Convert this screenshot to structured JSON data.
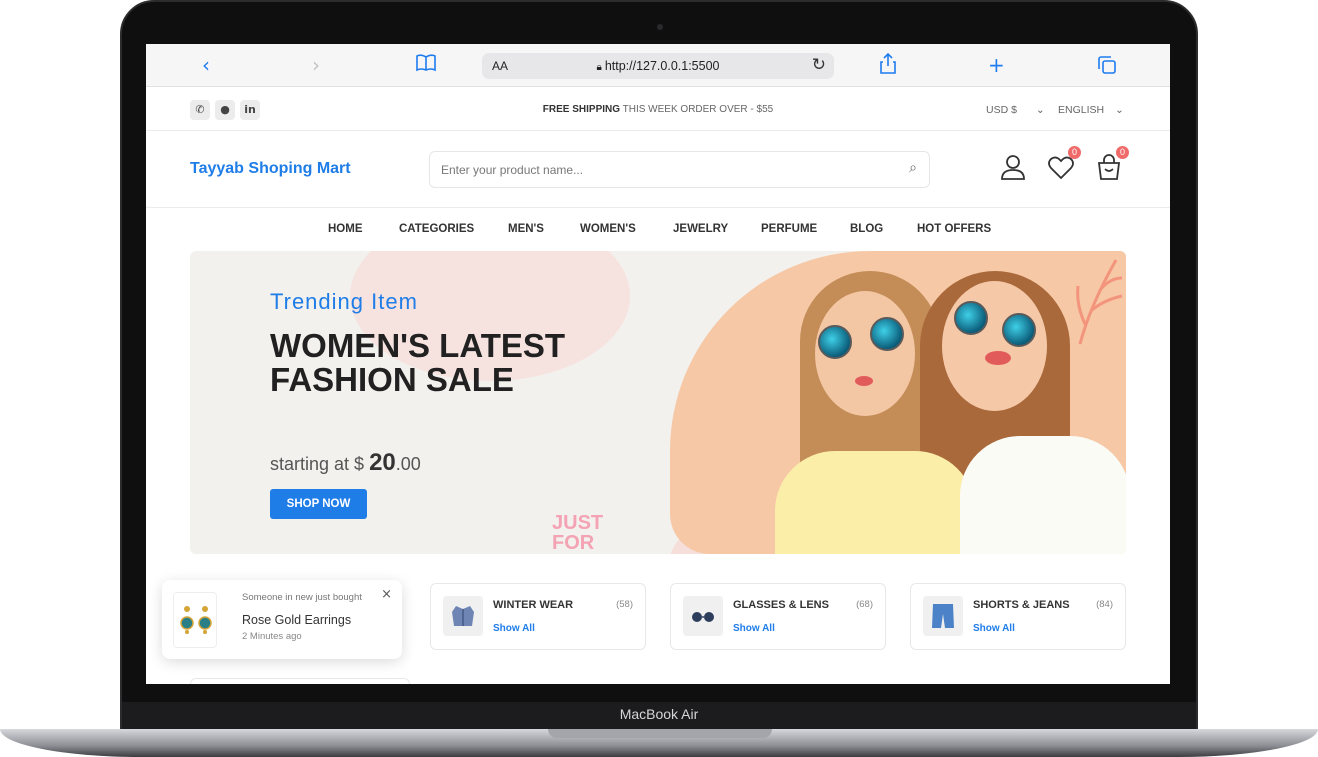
{
  "device": {
    "model_label": "MacBook Air"
  },
  "browser": {
    "text_size_label": "AA",
    "url": "http://127.0.0.1:5500",
    "back_icon": "chevron-left",
    "forward_icon": "chevron-right",
    "bookmarks_icon": "book",
    "reload_icon": "reload",
    "share_icon": "share",
    "new_tab_icon": "plus",
    "tabs_icon": "tabs"
  },
  "topstrip": {
    "social_icons": [
      "whatsapp-icon",
      "github-icon",
      "linkedin-icon"
    ],
    "shipping_bold": "FREE SHIPPING",
    "shipping_rest": " THIS WEEK ORDER OVER - $55",
    "currency": "USD $",
    "language": "ENGLISH"
  },
  "header": {
    "logo": "Tayyab Shoping Mart",
    "search_placeholder": "Enter your product name...",
    "wishlist_count": "0",
    "cart_count": "0"
  },
  "nav": {
    "items": [
      "HOME",
      "CATEGORIES",
      "MEN'S",
      "WOMEN'S",
      "JEWELRY",
      "PERFUME",
      "BLOG",
      "HOT OFFERS"
    ]
  },
  "banner": {
    "subtitle": "Trending Item",
    "title": "WOMEN'S LATEST FASHION SALE",
    "price_prefix": "starting at $ ",
    "price_main": "20",
    "price_cents": ".00",
    "button": "SHOP NOW",
    "decor_text": "JUST FOR"
  },
  "notification": {
    "title": "Someone in new just bought",
    "product": "Rose Gold Earrings",
    "time": "2 Minutes ago",
    "close": "×"
  },
  "categories": [
    {
      "name": "WINTER WEAR",
      "count": "(58)",
      "link": "Show All"
    },
    {
      "name": "GLASSES & LENS",
      "count": "(68)",
      "link": "Show All"
    },
    {
      "name": "SHORTS & JEANS",
      "count": "(84)",
      "link": "Show All"
    }
  ],
  "colors": {
    "accent": "#1f7de8",
    "badge": "#f06a6a",
    "banner_bg": "#f3f1ee",
    "banner_peach": "#f6c8a6"
  }
}
